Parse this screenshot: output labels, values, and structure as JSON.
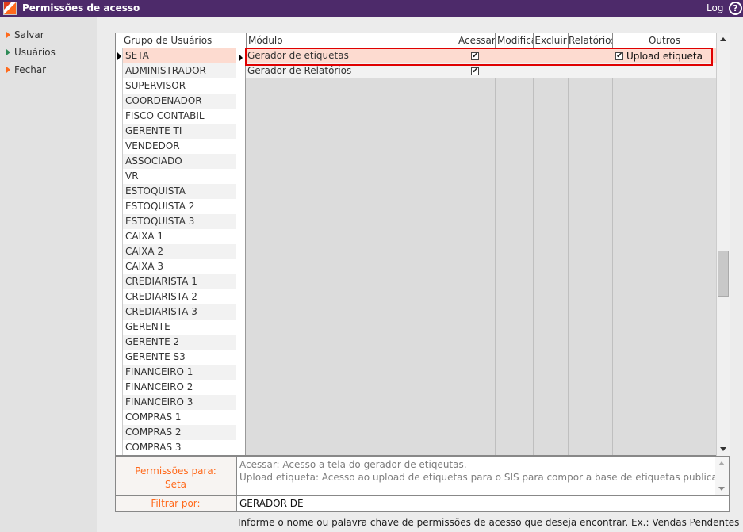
{
  "window": {
    "title": "Permissões de acesso",
    "log_label": "Log",
    "help_glyph": "?"
  },
  "sidebar": {
    "items": [
      {
        "label": "Salvar",
        "color": "#ff6a1c"
      },
      {
        "label": "Usuários",
        "color": "#2e8b57"
      },
      {
        "label": "Fechar",
        "color": "#ff6a1c"
      }
    ]
  },
  "groups": {
    "header": "Grupo de Usuários",
    "rows": [
      "SETA",
      "ADMINISTRADOR",
      "SUPERVISOR",
      "COORDENADOR",
      "FISCO CONTABIL",
      "GERENTE TI",
      "VENDEDOR",
      "ASSOCIADO",
      "VR",
      "ESTOQUISTA",
      "ESTOQUISTA 2",
      "ESTOQUISTA 3",
      "CAIXA 1",
      "CAIXA 2",
      "CAIXA 3",
      "CREDIARISTA 1",
      "CREDIARISTA 2",
      "CREDIARISTA 3",
      "GERENTE",
      "GERENTE 2",
      "GERENTE S3",
      "FINANCEIRO 1",
      "FINANCEIRO 2",
      "FINANCEIRO 3",
      "COMPRAS 1",
      "COMPRAS 2",
      "COMPRAS 3"
    ],
    "selected": "SETA"
  },
  "modules": {
    "headers": {
      "modulo": "Módulo",
      "acessar": "Acessar",
      "modificar": "Modificar",
      "excluir": "Excluir",
      "relatorios": "Relatórios",
      "outros": "Outros"
    },
    "rows": [
      {
        "name": "Gerador de etiquetas",
        "acessar": true,
        "outros_label": "Upload etiqueta",
        "outros_checked": true
      },
      {
        "name": "Gerador de Relatórios",
        "acessar": true
      }
    ],
    "check_glyph": "✔"
  },
  "permissions": {
    "label": "Permissões para:",
    "group": "Seta",
    "description_line1": "Acessar: Acesso a tela do gerador de etiqeutas.",
    "description_line2": "Upload etiqueta: Acesso ao upload de etiquetas para o SIS para compor a base de etiquetas publicas."
  },
  "filter": {
    "label": "Filtrar por:",
    "value": "GERADOR DE",
    "hint": "Informe o nome ou palavra chave de permissões de acesso que deseja encontrar. Ex.: Vendas Pendentes"
  },
  "colors": {
    "titlebar": "#4d2a6a",
    "accent": "#ff6a1c",
    "selected_row": "#fddbd0",
    "highlight_border": "#e00000"
  }
}
